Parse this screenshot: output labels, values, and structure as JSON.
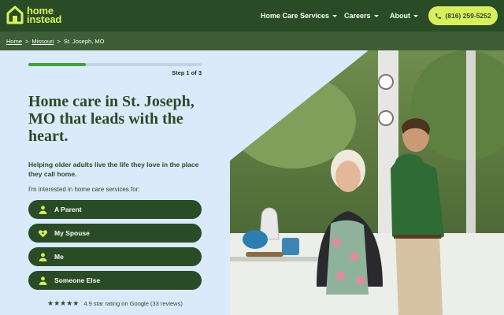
{
  "header": {
    "logo_line1": "home",
    "logo_line2": "instead",
    "nav": [
      {
        "label": "Home Care Services"
      },
      {
        "label": "Careers"
      },
      {
        "label": "About"
      }
    ],
    "phone": "(816) 259-5252"
  },
  "breadcrumb": {
    "items": [
      "Home",
      "Missouri",
      "St. Joseph, MO"
    ]
  },
  "form": {
    "progress_fraction": 0.33,
    "step_label": "Step 1 of 3",
    "headline": "Home care in St. Joseph, MO that leads with the heart.",
    "subheadline": "Helping older adults live the life they love in the place they call home.",
    "prompt": "I'm interested in home care services for:",
    "options": [
      {
        "label": "A Parent",
        "icon": "person-icon"
      },
      {
        "label": "My Spouse",
        "icon": "heart-icon"
      },
      {
        "label": "Me",
        "icon": "person-icon"
      },
      {
        "label": "Someone Else",
        "icon": "person-icon"
      }
    ]
  },
  "rating": {
    "stars": "★★★★★",
    "text": "4.9 star rating on Google (33 reviews)"
  },
  "colors": {
    "brand_green": "#294b25",
    "accent_lime": "#d9f05e",
    "panel_blue": "#dbeafb",
    "progress_green": "#3da33b"
  }
}
